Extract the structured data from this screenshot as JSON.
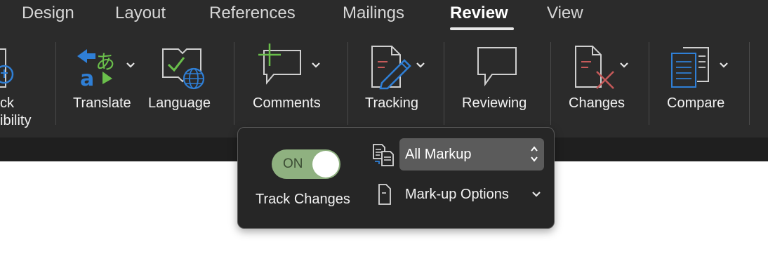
{
  "tabs": [
    {
      "label": "Design",
      "active": false
    },
    {
      "label": "Layout",
      "active": false
    },
    {
      "label": "References",
      "active": false
    },
    {
      "label": "Mailings",
      "active": false
    },
    {
      "label": "Review",
      "active": true
    },
    {
      "label": "View",
      "active": false
    }
  ],
  "ribbon": {
    "partial_label_line1": "ck",
    "partial_label_line2": "ibility",
    "translate": "Translate",
    "language": "Language",
    "comments": "Comments",
    "tracking": "Tracking",
    "reviewing": "Reviewing",
    "changes": "Changes",
    "compare": "Compare"
  },
  "tracking_popup": {
    "toggle_state": "ON",
    "track_changes_label": "Track Changes",
    "display_select_value": "All Markup",
    "markup_options_label": "Mark-up Options"
  },
  "colors": {
    "ribbon_bg": "#2b2b2b",
    "toggle_on": "#8fb180",
    "accent_blue": "#2f7fd6",
    "accent_green": "#6abf4b",
    "reject_red": "#c65a5a"
  },
  "icons": {
    "accessibility": "accessibility-icon",
    "translate": "translate-icon",
    "language": "language-icon",
    "comments": "comment-add-icon",
    "tracking": "document-pencil-icon",
    "reviewing": "speech-bubble-icon",
    "changes": "document-reject-icon",
    "compare": "compare-documents-icon",
    "display_for_review": "display-for-review-icon",
    "markup_options": "markup-options-icon"
  }
}
